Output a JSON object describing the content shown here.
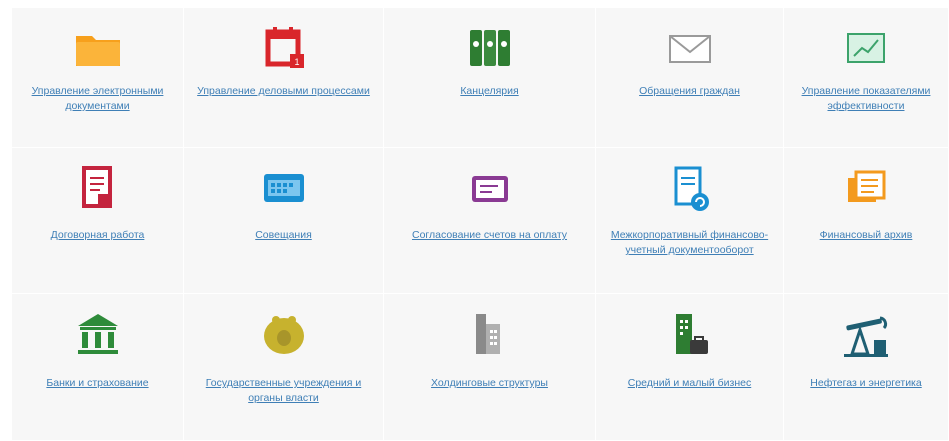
{
  "tiles": [
    {
      "label": "Управление электронными документами",
      "icon": "folder-icon",
      "color": "#f7a01c"
    },
    {
      "label": "Управление деловыми процессами",
      "icon": "calendar-icon",
      "color": "#d9262b"
    },
    {
      "label": "Канцелярия",
      "icon": "binders-icon",
      "color": "#3b8a3e"
    },
    {
      "label": "Обращения граждан",
      "icon": "envelope-icon",
      "color": "#9a9a9a"
    },
    {
      "label": "Управление показателями эффективности",
      "icon": "chart-icon",
      "color": "#3ca36b"
    },
    {
      "label": "Договорная работа",
      "icon": "contract-icon",
      "color": "#c4243e"
    },
    {
      "label": "Совещания",
      "icon": "meeting-board-icon",
      "color": "#1a8fd1"
    },
    {
      "label": "Согласование счетов на оплату",
      "icon": "invoice-icon",
      "color": "#8a3a93"
    },
    {
      "label": "Межкорпоративный финансово-учетный документооборот",
      "icon": "document-exchange-icon",
      "color": "#1a8fd1"
    },
    {
      "label": "Финансовый архив",
      "icon": "archive-icon",
      "color": "#f39a1e"
    },
    {
      "label": "Банки и страхование",
      "icon": "bank-icon",
      "color": "#2e8b3a"
    },
    {
      "label": "Государственные учреждения и органы власти",
      "icon": "coat-of-arms-icon",
      "color": "#c7b22e"
    },
    {
      "label": "Холдинговые структуры",
      "icon": "buildings-icon",
      "color": "#8a8a8a"
    },
    {
      "label": "Средний и малый бизнес",
      "icon": "office-briefcase-icon",
      "color": "#2e7d32"
    },
    {
      "label": "Нефтегаз и энергетика",
      "icon": "oil-pump-icon",
      "color": "#1f5f73"
    }
  ]
}
